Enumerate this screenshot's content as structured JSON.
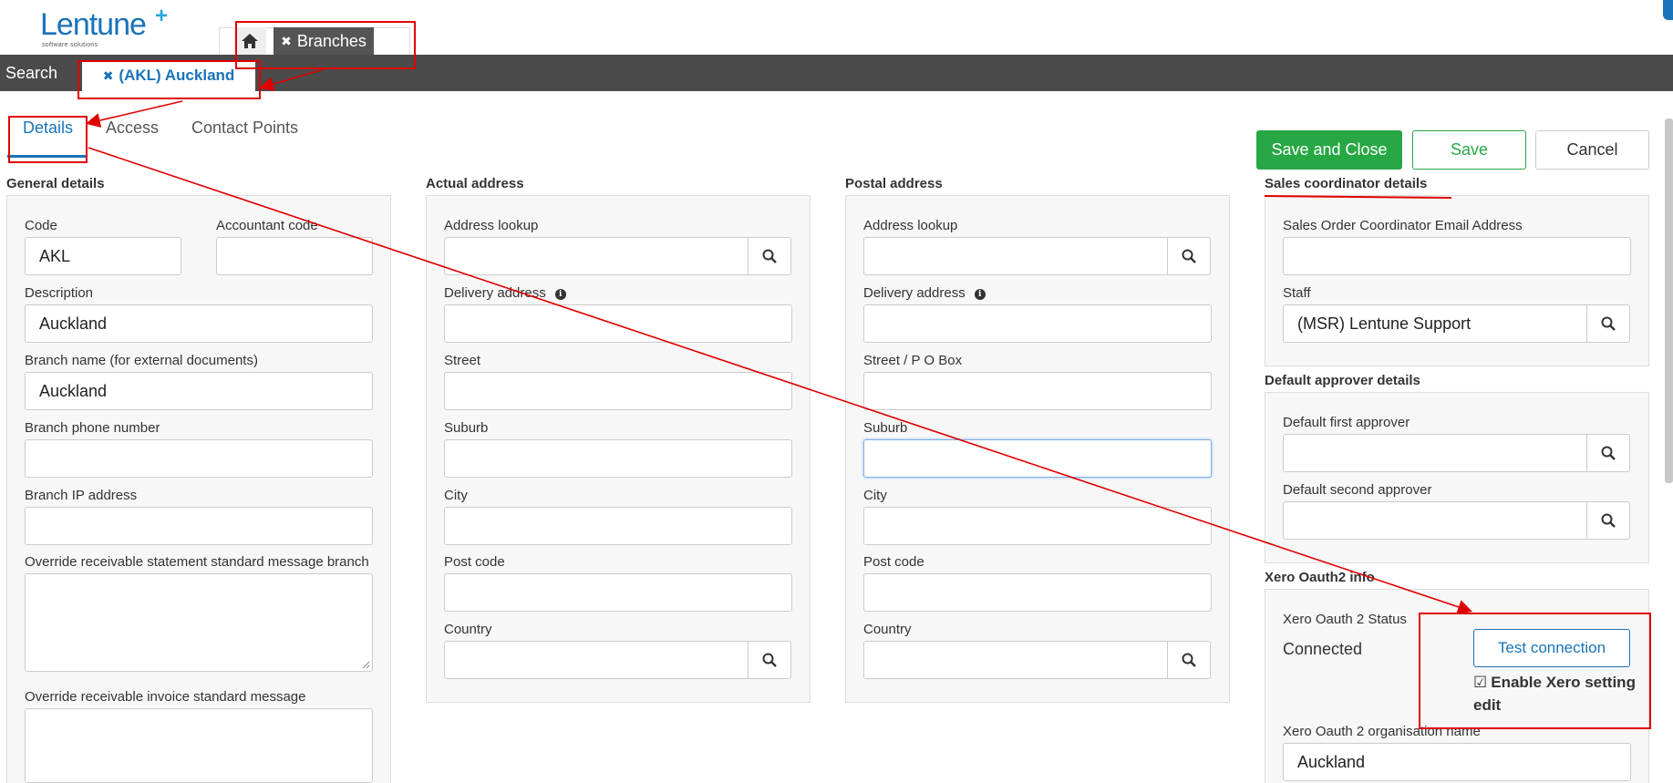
{
  "app": {
    "logo_text": "Lentune",
    "logo_plus": "+",
    "logo_sub": "software solutions"
  },
  "top_tabs": {
    "branches_label": "Branches"
  },
  "navbar": {
    "search_label": "Search",
    "open_tab_label": "(AKL) Auckland"
  },
  "subtabs": {
    "details": "Details",
    "access": "Access",
    "contact_points": "Contact Points"
  },
  "actions": {
    "save_close": "Save and Close",
    "save": "Save",
    "cancel": "Cancel"
  },
  "general": {
    "title": "General details",
    "code_label": "Code",
    "code_value": "AKL",
    "accountant_code_label": "Accountant code",
    "accountant_code_value": "",
    "description_label": "Description",
    "description_value": "Auckland",
    "branch_name_label": "Branch name (for external documents)",
    "branch_name_value": "Auckland",
    "phone_label": "Branch phone number",
    "phone_value": "",
    "ip_label": "Branch IP address",
    "ip_value": "",
    "override_statement_label": "Override receivable statement standard message branch",
    "override_invoice_label": "Override receivable invoice standard message"
  },
  "actual_address": {
    "title": "Actual address",
    "lookup_label": "Address lookup",
    "delivery_label": "Delivery address",
    "street_label": "Street",
    "suburb_label": "Suburb",
    "city_label": "City",
    "postcode_label": "Post code",
    "country_label": "Country"
  },
  "postal_address": {
    "title": "Postal address",
    "lookup_label": "Address lookup",
    "delivery_label": "Delivery address",
    "street_label": "Street / P O Box",
    "suburb_label": "Suburb",
    "city_label": "City",
    "postcode_label": "Post code",
    "country_label": "Country"
  },
  "sales_coordinator": {
    "title": "Sales coordinator details",
    "email_label": "Sales Order Coordinator Email Address",
    "email_value": "",
    "staff_label": "Staff",
    "staff_value": "(MSR) Lentune Support"
  },
  "approver": {
    "title": "Default approver details",
    "first_label": "Default first approver",
    "second_label": "Default second approver"
  },
  "xero": {
    "title": "Xero Oauth2 info",
    "status_label": "Xero Oauth 2 Status",
    "status_value": "Connected",
    "test_button": "Test connection",
    "enable_edit_label": "Enable Xero setting edit",
    "org_label": "Xero Oauth 2 organisation name",
    "org_value": "Auckland"
  },
  "colors": {
    "brand": "#1a73b8",
    "success": "#28a745",
    "annotation": "#e00000",
    "navbar": "#4a4a4a"
  }
}
